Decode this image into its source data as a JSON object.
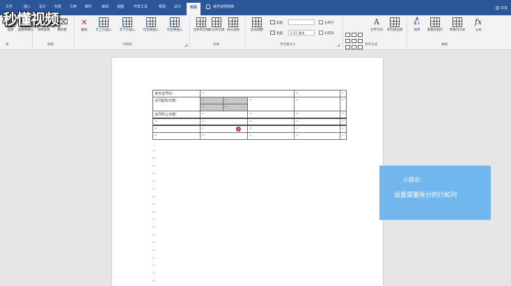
{
  "tabs": [
    {
      "label": "文件",
      "active": false
    },
    {
      "label": "插入",
      "active": false
    },
    {
      "label": "设计",
      "active": false
    },
    {
      "label": "布局",
      "active": false
    },
    {
      "label": "引用",
      "active": false
    },
    {
      "label": "邮件",
      "active": false
    },
    {
      "label": "审阅",
      "active": false
    },
    {
      "label": "视图",
      "active": false
    },
    {
      "label": "开发工具",
      "active": false
    },
    {
      "label": "帮助",
      "active": false
    },
    {
      "label": "设计",
      "active": false
    },
    {
      "label": "布局",
      "active": true
    }
  ],
  "tell_me": "操作说明搜索",
  "share": "共享",
  "watermark": "秒懂视频",
  "ribbon": {
    "table_group": {
      "buttons": [
        "选择",
        "查看网格线",
        "属性"
      ],
      "label": "表"
    },
    "draw_group": {
      "buttons": [
        "绘制表格",
        "橡皮擦"
      ],
      "label": "绘图"
    },
    "rows_cols": {
      "buttons": [
        "删除",
        "在上方插入",
        "在下方插入",
        "在左侧插入",
        "在右侧插入"
      ],
      "label": "行和列"
    },
    "merge": {
      "buttons": [
        "合并单元格",
        "拆分单元格",
        "拆分表格"
      ],
      "label": "合并"
    },
    "cell_size": {
      "autofit": "自动调整",
      "height_label": "高度:",
      "height_value": "",
      "width_label": "宽度:",
      "width_value": "1.61 厘米",
      "distribute_rows": "分布行",
      "distribute_cols": "分布列",
      "label": "单元格大小"
    },
    "alignment": {
      "buttons": [
        "文字方向",
        "单元格边距"
      ],
      "label": "对齐方式"
    },
    "data": {
      "buttons": [
        "排序",
        "重复标题行",
        "转换为文本",
        "公式"
      ],
      "formula_icon": "fx",
      "label": "数据"
    }
  },
  "table": {
    "rows": [
      {
        "c1": "身份证号码：",
        "c4": "",
        "c5": ""
      },
      {
        "c1": "合同起始日期：",
        "c3": "",
        "c4": "",
        "c5": ""
      },
      {
        "c1": "合同终止日期：",
        "c2": "",
        "c3": "",
        "c4": "",
        "c5": ""
      },
      {
        "c1": "",
        "c2": "",
        "c3": "",
        "c4": "",
        "c5": ""
      },
      {
        "c1": "",
        "c2": "",
        "c3": "",
        "c4": "",
        "c5": ""
      },
      {
        "c1": "",
        "c2": "",
        "c3": "",
        "c4": "",
        "c5": ""
      }
    ],
    "paragraph_mark": "↵"
  },
  "tip": {
    "title": "小提示：",
    "text": "设置需要拆分的行和列"
  }
}
